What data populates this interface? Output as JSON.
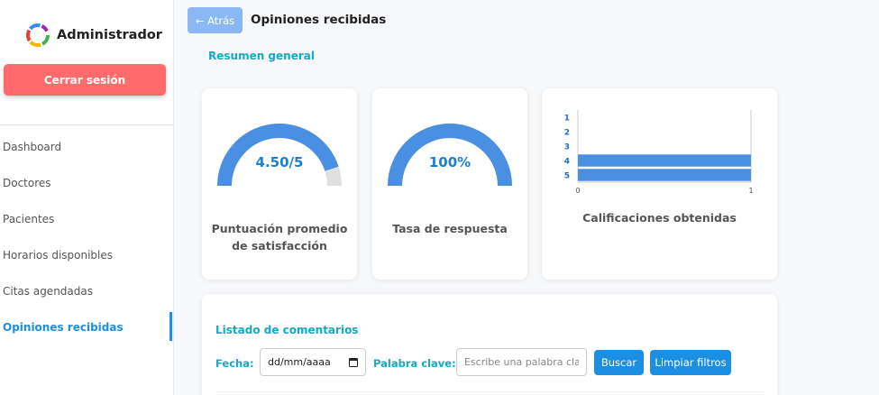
{
  "sidebar": {
    "brand": "Administrador",
    "logout_label": "Cerrar sesión",
    "items": [
      {
        "label": "Dashboard"
      },
      {
        "label": "Doctores"
      },
      {
        "label": "Pacientes"
      },
      {
        "label": "Horarios disponibles"
      },
      {
        "label": "Citas agendadas"
      },
      {
        "label": "Opiniones recibidas",
        "active": true
      }
    ]
  },
  "header": {
    "back_label": "← Atrás",
    "title": "Opiniones recibidas"
  },
  "summary": {
    "title": "Resumen general",
    "satisfaction": {
      "value_text": "4.50/5",
      "value": 4.5,
      "max": 5,
      "label_line1": "Puntuación promedio",
      "label_line2": "de satisfacción"
    },
    "response_rate": {
      "value_text": "100%",
      "value": 100,
      "max": 100,
      "label": "Tasa de respuesta"
    },
    "ratings_label": "Calificaciones obtenidas"
  },
  "chart_data": {
    "type": "bar",
    "orientation": "horizontal",
    "categories": [
      "1",
      "2",
      "3",
      "4",
      "5"
    ],
    "values": [
      0,
      0,
      0,
      1,
      1
    ],
    "xlim": [
      0,
      1
    ],
    "x_ticks": [
      "0",
      "1"
    ],
    "title": "",
    "xlabel": "",
    "ylabel": "",
    "color": "#4a90e2"
  },
  "comments": {
    "title": "Listado de comentarios",
    "date_label": "Fecha:",
    "date_value": "dd/mm/aaaa",
    "keyword_label": "Palabra clave:",
    "keyword_placeholder": "Escribe una palabra clave",
    "search_label": "Buscar",
    "clear_label": "Limpiar filtros"
  },
  "colors": {
    "accent": "#1a8fe3",
    "teal": "#17a9c4",
    "gauge": "#4a90e2",
    "gauge_track": "#e0e0e0",
    "logout": "#ff6b6b"
  }
}
